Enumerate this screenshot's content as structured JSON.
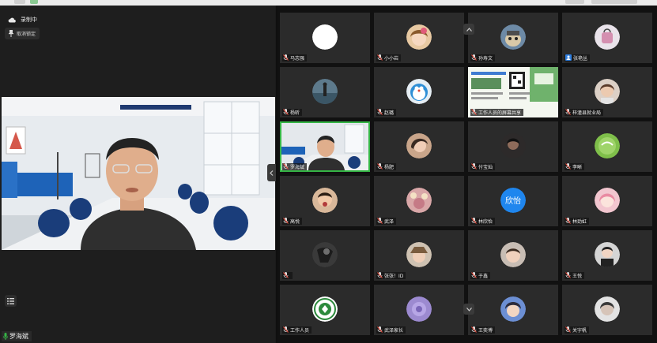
{
  "recording": {
    "label": "录制中"
  },
  "pin": {
    "label": "取消锁定"
  },
  "speaker": {
    "name": "罗海斌"
  },
  "participants": [
    {
      "name": "马志强",
      "avatar": "white-circle"
    },
    {
      "name": "小小岩",
      "avatar": "cartoon-girl"
    },
    {
      "name": "孙寿文",
      "avatar": "cartoon-dog"
    },
    {
      "name": "张艳丛",
      "avatar": "pink-bag"
    },
    {
      "name": "杨昕",
      "avatar": "person-lake"
    },
    {
      "name": "赵璐",
      "avatar": "doraemon"
    },
    {
      "name": "工作人员的屏幕共享",
      "avatar": "screen-share"
    },
    {
      "name": "梓潼县就业局",
      "avatar": "woman-portrait"
    },
    {
      "name": "罗海斌",
      "avatar": "speaker-video"
    },
    {
      "name": "杨肥",
      "avatar": "woman-face"
    },
    {
      "name": "付宝灿",
      "avatar": "dark-portrait"
    },
    {
      "name": "李晰",
      "avatar": "green-sprite"
    },
    {
      "name": "高悦",
      "avatar": "child-eating"
    },
    {
      "name": "武泽",
      "avatar": "anime-flowers"
    },
    {
      "name": "林欣怡",
      "avatar": "text-avatar",
      "avatar_text": "欣怡"
    },
    {
      "name": "林劲虹",
      "avatar": "pink-anime"
    },
    {
      "name": "",
      "avatar": "dark-figure"
    },
    {
      "name": "张张！ID",
      "avatar": "girl-hat"
    },
    {
      "name": "于鑫",
      "avatar": "child-face"
    },
    {
      "name": "王悦",
      "avatar": "girl-gesture"
    },
    {
      "name": "工作人员",
      "avatar": "emblem"
    },
    {
      "name": "武泽家长",
      "avatar": "purple-flower"
    },
    {
      "name": "王奕博",
      "avatar": "anime-boy"
    },
    {
      "name": "关字帆",
      "avatar": "woman-bw"
    }
  ],
  "colors": {
    "active_border": "#35b545",
    "tile_bg": "#2b2b2b",
    "text_avatar_bg": "#1f86ee"
  },
  "icons": {
    "mic": "mic-icon",
    "pin": "pin-icon",
    "cloud": "cloud-icon",
    "list": "list-icon"
  }
}
